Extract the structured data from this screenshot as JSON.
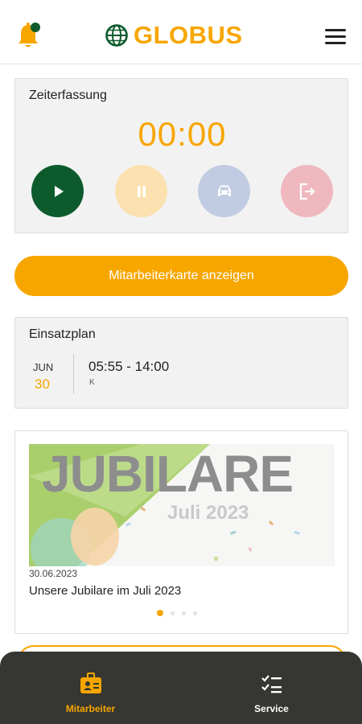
{
  "header": {
    "brand": "GLOBUS",
    "notification_icon": "bell-icon",
    "menu_icon": "hamburger-menu-icon"
  },
  "time_tracking": {
    "title": "Zeiterfassung",
    "timer": "00:00",
    "buttons": [
      {
        "icon": "play-icon",
        "color": "#0d5b2d"
      },
      {
        "icon": "pause-icon",
        "color": "#fbe1b0"
      },
      {
        "icon": "car-icon",
        "color": "#c1cce3"
      },
      {
        "icon": "exit-icon",
        "color": "#efb8be"
      }
    ]
  },
  "employee_card_button": "Mitarbeiterkarte anzeigen",
  "schedule": {
    "title": "Einsatzplan",
    "month": "JUN",
    "day": "30",
    "time": "05:55 - 14:00",
    "code": "K"
  },
  "news": {
    "image_title": "JUBILARE",
    "image_subtitle": "Juli 2023",
    "date": "30.06.2023",
    "caption": "Unsere Jubilare im Juli 2023",
    "pages": 4,
    "active_page": 1
  },
  "bottom_nav": {
    "items": [
      {
        "label": "Mitarbeiter",
        "icon": "employee-badge-icon",
        "active": true
      },
      {
        "label": "Service",
        "icon": "checklist-icon",
        "active": false
      }
    ]
  },
  "colors": {
    "accent": "#f7a600",
    "dark_green": "#0d5b2d",
    "nav_background": "#363732"
  }
}
